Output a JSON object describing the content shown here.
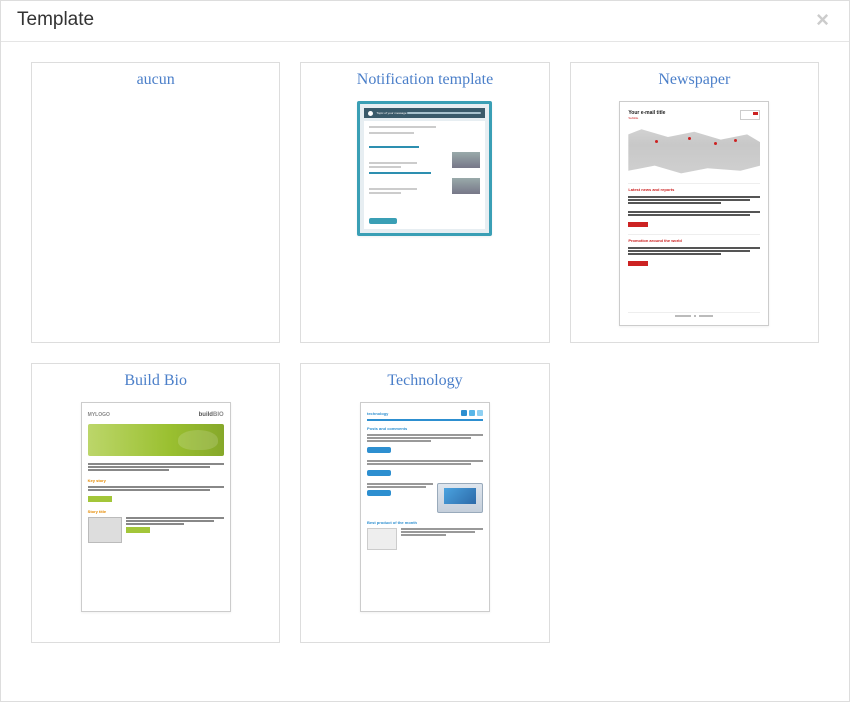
{
  "modal": {
    "title": "Template",
    "close": "×"
  },
  "templates": [
    {
      "id": "aucun",
      "title": "aucun"
    },
    {
      "id": "notification",
      "title": "Notification template"
    },
    {
      "id": "newspaper",
      "title": "Newspaper"
    },
    {
      "id": "buildbio",
      "title": "Build Bio"
    },
    {
      "id": "technology",
      "title": "Technology"
    }
  ],
  "thumbs": {
    "notification": {
      "subject": "Topic of your message"
    },
    "newspaper": {
      "title": "Your e-mail title",
      "subtitle": "Subtitle",
      "section1": "Latest news and reports",
      "section2": "Promotion around the world"
    },
    "buildbio": {
      "logo1": "MYLOGO",
      "logo2": "build",
      "logo3": "BIO",
      "sec1": "Key story",
      "sec2": "Story title"
    },
    "technology": {
      "logo": "technology",
      "sec1": "Posts and comments",
      "sec2": "Best product of the month"
    }
  }
}
